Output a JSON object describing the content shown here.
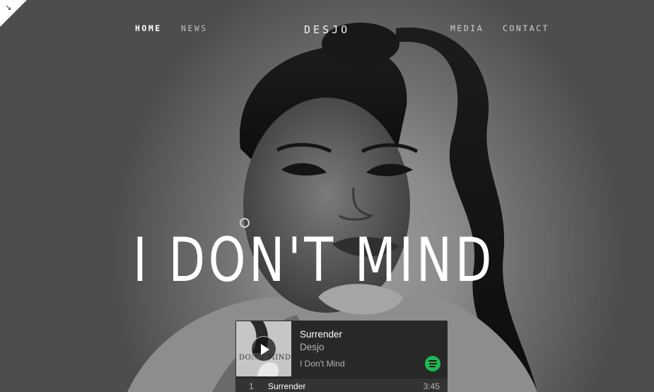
{
  "nav": {
    "home": "HOME",
    "news": "NEWS",
    "brand": "DESJO",
    "media": "MEDIA",
    "contact": "CONTACT"
  },
  "hero": {
    "headline": "I DON'T MIND"
  },
  "player": {
    "track_title": "Surrender",
    "artist": "Desjo",
    "album": "I Don't Mind",
    "art_text": "DON'T MIND",
    "tracklist": [
      {
        "number": "1",
        "title": "Surrender",
        "duration": "3:45"
      }
    ]
  },
  "icons": {
    "corner": "expand-arrow-icon",
    "play": "play-icon",
    "spotify": "spotify-icon"
  },
  "colors": {
    "spotify_green": "#1db954",
    "player_bg": "#282828",
    "text_white": "#ffffff"
  }
}
